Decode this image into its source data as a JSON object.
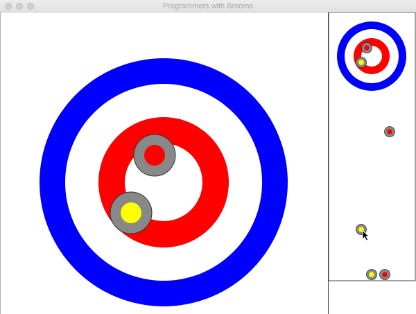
{
  "window": {
    "title": "Programmers with Brooms"
  },
  "colors": {
    "house_outer": "#0000ff",
    "house_middle": "#ffffff",
    "house_inner": "#ff0000",
    "stone_body": "#888888",
    "stone_outline": "#333333",
    "team_red": "#ff0000",
    "team_yellow": "#ffff00",
    "panel_border": "#444444"
  },
  "icons": {
    "cursor": "arrow-cursor-icon"
  }
}
